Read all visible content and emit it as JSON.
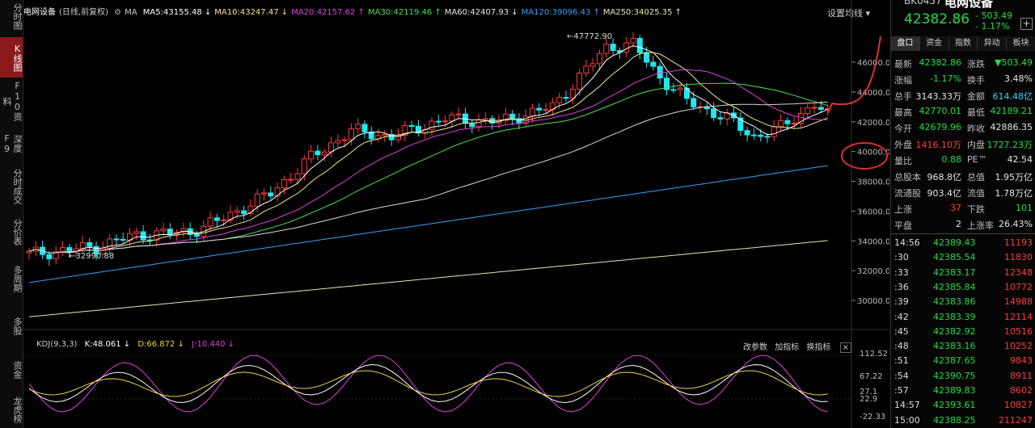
{
  "sidebar": {
    "tabs": [
      "分时图",
      "K线图",
      "F10资料",
      "深度F9",
      "分时成交",
      "分价表",
      "多周期",
      "多股",
      "资金",
      "龙虎榜"
    ],
    "active": 1
  },
  "header": {
    "title": "电网设备",
    "period": "(日线,前复权)",
    "ma_prefix": "MA",
    "ma": [
      {
        "label": "MA5:43155.48",
        "arrow": "↓",
        "color": "#ffffff"
      },
      {
        "label": "MA10:43247.47",
        "arrow": "↓",
        "color": "#f0e68c"
      },
      {
        "label": "MA20:42157.62",
        "arrow": "↑",
        "color": "#e040e0"
      },
      {
        "label": "MA30:42119.46",
        "arrow": "↑",
        "color": "#50e050"
      },
      {
        "label": "MA60:42407.93",
        "arrow": "↓",
        "color": "#e6e6e6"
      },
      {
        "label": "MA120:39096.43",
        "arrow": "↑",
        "color": "#35a0ff"
      },
      {
        "label": "MA250:34025.35",
        "arrow": "↑",
        "color": "#e6e6b0"
      }
    ],
    "settings": "设置均线"
  },
  "annotations": {
    "high": "47772.90",
    "low": "32990.88"
  },
  "kdj": {
    "title": "KDJ(9,3,3)",
    "k": "K:48.061",
    "d": "D:66.872",
    "j": "J:10.440",
    "links": [
      "改参数",
      "加指标",
      "换指标"
    ],
    "close": "×"
  },
  "chart_data": {
    "type": "candlestick",
    "y_axis_ticks": [
      46000,
      44000,
      42000,
      40000,
      38000,
      36000,
      34000,
      32000,
      30000
    ],
    "kdj_axis_ticks": [
      "112.52",
      "67.22",
      "27.1",
      "22.9",
      "-22.33"
    ],
    "high_label": 47772.9,
    "low_label": 32990.88
  },
  "quote": {
    "code": "BK0457",
    "name": "电网设备",
    "price": "42382.86",
    "change": "- 503.49",
    "pct": "- 1.17%"
  },
  "tabs": [
    "盘口",
    "资金",
    "指数",
    "异动",
    "板块"
  ],
  "fields": [
    [
      "最新",
      "42382.86",
      "green",
      "涨跌",
      "▼503.49",
      "green"
    ],
    [
      "涨幅",
      "-1.17%",
      "green",
      "换手",
      "3.48%",
      "white"
    ],
    [
      "总手",
      "3143.33万",
      "white",
      "金额",
      "614.48亿",
      "cyan"
    ],
    [
      "最高",
      "42770.01",
      "green",
      "最低",
      "42189.21",
      "green"
    ],
    [
      "今开",
      "42679.96",
      "green",
      "昨收",
      "42886.35",
      "white"
    ],
    [
      "外盘",
      "1416.10万",
      "red",
      "内盘",
      "1727.23万",
      "green"
    ],
    [
      "量比",
      "0.88",
      "green",
      "PE™",
      "42.54",
      "white"
    ],
    [
      "总股本",
      "968.8亿",
      "white",
      "总值",
      "1.95万亿",
      "white"
    ],
    [
      "流通股",
      "903.4亿",
      "white",
      "流值",
      "1.78万亿",
      "white"
    ],
    [
      "上涨",
      "37",
      "red",
      "下跌",
      "101",
      "green"
    ],
    [
      "平盘",
      "2",
      "white",
      "上涨率",
      "26.43%",
      "white"
    ]
  ],
  "ticks": [
    [
      "14:56",
      "42389.43",
      "11193"
    ],
    [
      ":30",
      "42385.54",
      "11830"
    ],
    [
      ":33",
      "42383.17",
      "12348"
    ],
    [
      ":36",
      "42385.84",
      "10772"
    ],
    [
      ":39",
      "42383.86",
      "14988"
    ],
    [
      ":42",
      "42383.39",
      "12114"
    ],
    [
      ":45",
      "42382.92",
      "10516"
    ],
    [
      ":48",
      "42383.16",
      "10252"
    ],
    [
      ":51",
      "42387.65",
      "9843"
    ],
    [
      ":54",
      "42390.75",
      "8911"
    ],
    [
      ":57",
      "42389.83",
      "8602"
    ],
    [
      "14:57",
      "42393.61",
      "10827"
    ],
    [
      "15:00",
      "42388.25",
      "211247"
    ]
  ]
}
